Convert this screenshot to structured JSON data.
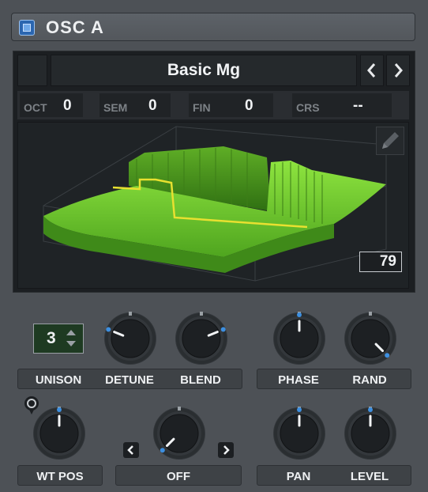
{
  "header": {
    "title": "OSC A",
    "enabled": true
  },
  "wavetable": {
    "name": "Basic Mg",
    "position_readout": "79",
    "edit_icon": "pencil-icon"
  },
  "pitch": {
    "oct_label": "OCT",
    "oct_value": "0",
    "sem_label": "SEM",
    "sem_value": "0",
    "fin_label": "FIN",
    "fin_value": "0",
    "crs_label": "CRS",
    "crs_value": "--"
  },
  "unison": {
    "value": "3"
  },
  "knobs": {
    "detune": {
      "label": "DETUNE",
      "value": 0.25
    },
    "blend": {
      "label": "BLEND",
      "value": 0.75
    },
    "phase": {
      "label": "PHASE",
      "value": 0.5
    },
    "rand": {
      "label": "RAND",
      "value": 1.0
    },
    "wt_pos": {
      "label": "WT POS",
      "value": 0.5
    },
    "warp": {
      "label": "OFF",
      "value": 0.0
    },
    "pan": {
      "label": "PAN",
      "value": 0.5
    },
    "level": {
      "label": "LEVEL",
      "value": 0.5
    }
  },
  "labels": {
    "unison": "UNISON"
  },
  "colors": {
    "accent": "#3d8fe0",
    "wavetable_green": "#6fcf2e",
    "waveform_yellow": "#e8e030"
  }
}
